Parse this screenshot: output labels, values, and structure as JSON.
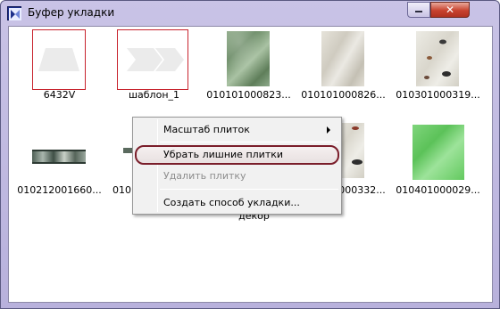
{
  "window": {
    "title": "Буфер укладки",
    "close_glyph": "✕",
    "colors": {
      "frame": "#c9c3e6",
      "close": "#c8422e",
      "selection_border": "#c8242e",
      "menu_highlight_border": "#7a1d2a"
    }
  },
  "tiles": [
    {
      "label": "6432V",
      "thumb": "shape-trapezoid",
      "selected": true
    },
    {
      "label": "шаблон_1",
      "thumb": "shape-chevron",
      "selected": true
    },
    {
      "label": "010101000823...",
      "thumb": "marble-green"
    },
    {
      "label": "010101000826...",
      "thumb": "marble-grey"
    },
    {
      "label": "010301000319...",
      "thumb": "marble-fish"
    },
    {
      "label": "010212001660...",
      "thumb": "border-strip"
    },
    {
      "label": "010",
      "thumb": "partial"
    },
    {
      "label": "010101000332...",
      "thumb": "marble-fish-partial"
    },
    {
      "label": "010401000029...",
      "thumb": "marble-bright"
    }
  ],
  "tile_extra_label": "декор",
  "context_menu": {
    "items": [
      {
        "label": "Масштаб плиток",
        "has_submenu": true,
        "enabled": true
      },
      {
        "label": "Убрать лишние плитки",
        "enabled": true,
        "highlighted": true
      },
      {
        "label": "Удалить плитку",
        "enabled": false
      },
      {
        "label": "Создать способ укладки...",
        "enabled": true
      }
    ]
  }
}
